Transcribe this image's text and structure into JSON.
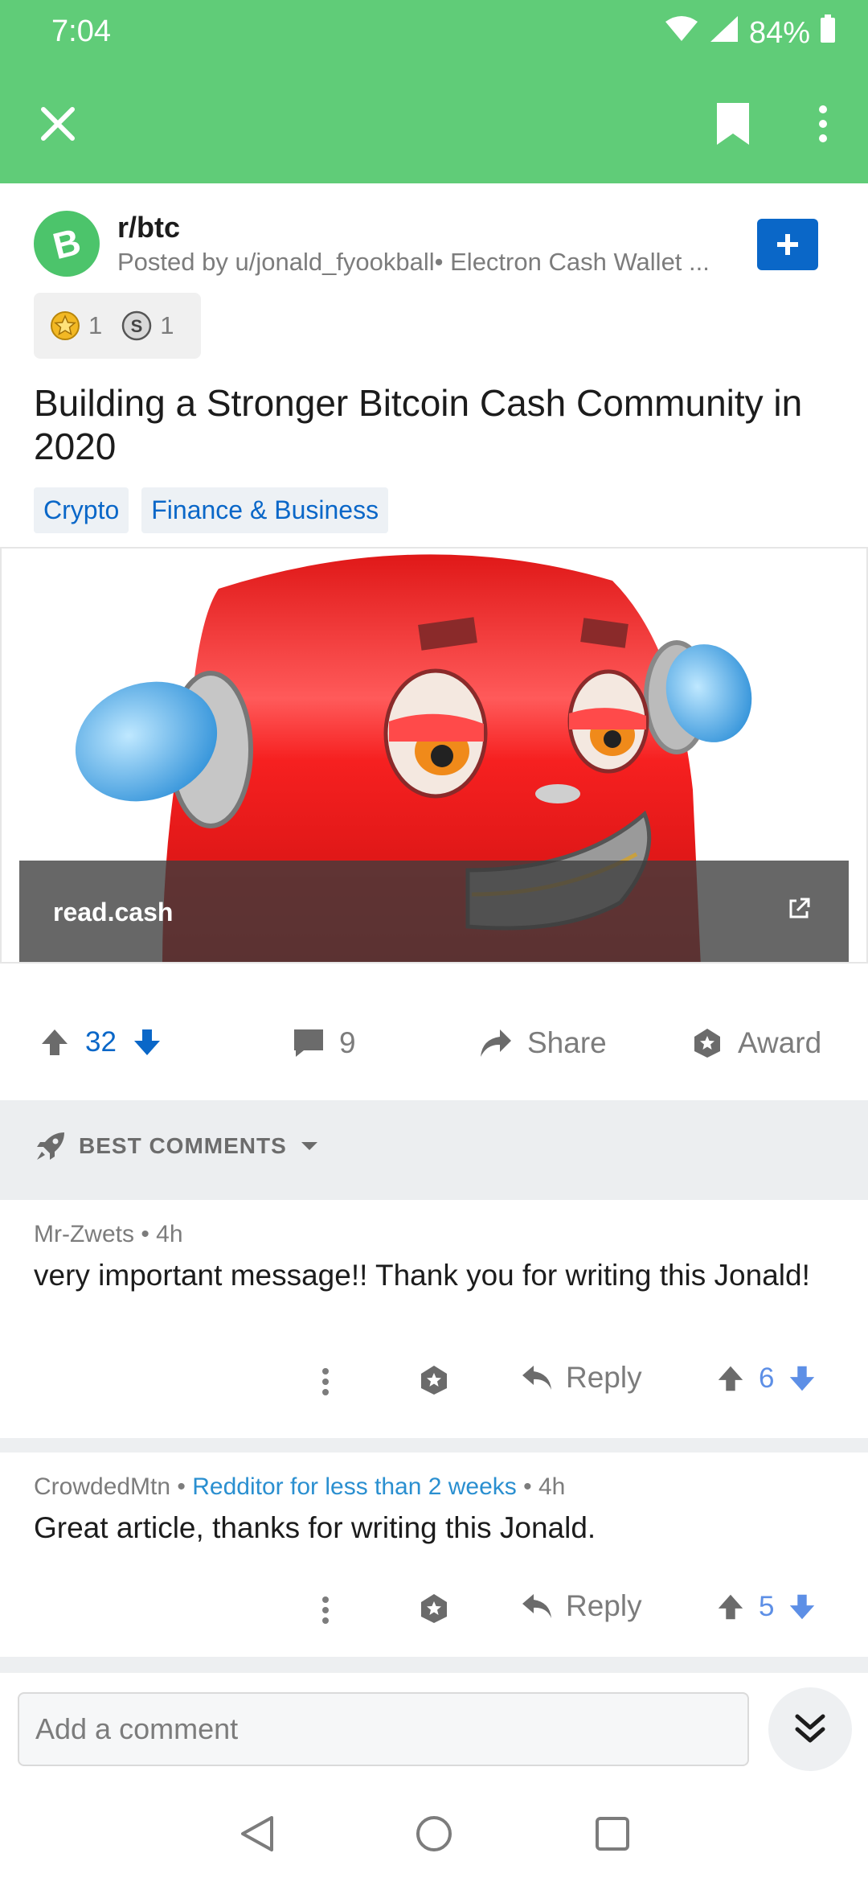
{
  "status": {
    "time": "7:04",
    "battery": "84%"
  },
  "post": {
    "subreddit": "r/btc",
    "meta": "Posted by u/jonald_fyookball• Electron Cash Wallet ...",
    "awards": [
      {
        "icon": "gold-star-award-icon",
        "count": "1"
      },
      {
        "icon": "silver-coin-award-icon",
        "count": "1"
      }
    ],
    "title": "Building a Stronger Bitcoin Cash Community in 2020",
    "flairs": [
      "Crypto",
      "Finance & Business"
    ],
    "link_domain": "read.cash",
    "votes": "32",
    "comments": "9",
    "share_label": "Share",
    "award_label": "Award"
  },
  "sort": {
    "label": "BEST COMMENTS"
  },
  "comments": [
    {
      "author": "Mr-Zwets",
      "flair": "",
      "age": "4h",
      "body": "very important message!! Thank you for writing this Jonald!",
      "reply_label": "Reply",
      "votes": "6"
    },
    {
      "author": "CrowdedMtn",
      "flair": "Redditor for less than 2 weeks",
      "age": "4h",
      "body": "Great article, thanks for writing this Jonald.",
      "reply_label": "Reply",
      "votes": "5"
    }
  ],
  "composer": {
    "placeholder": "Add a comment"
  },
  "colors": {
    "appbar": "#60cc78",
    "accent": "#0a67c8",
    "upvote_blue": "#5d8fe6"
  }
}
